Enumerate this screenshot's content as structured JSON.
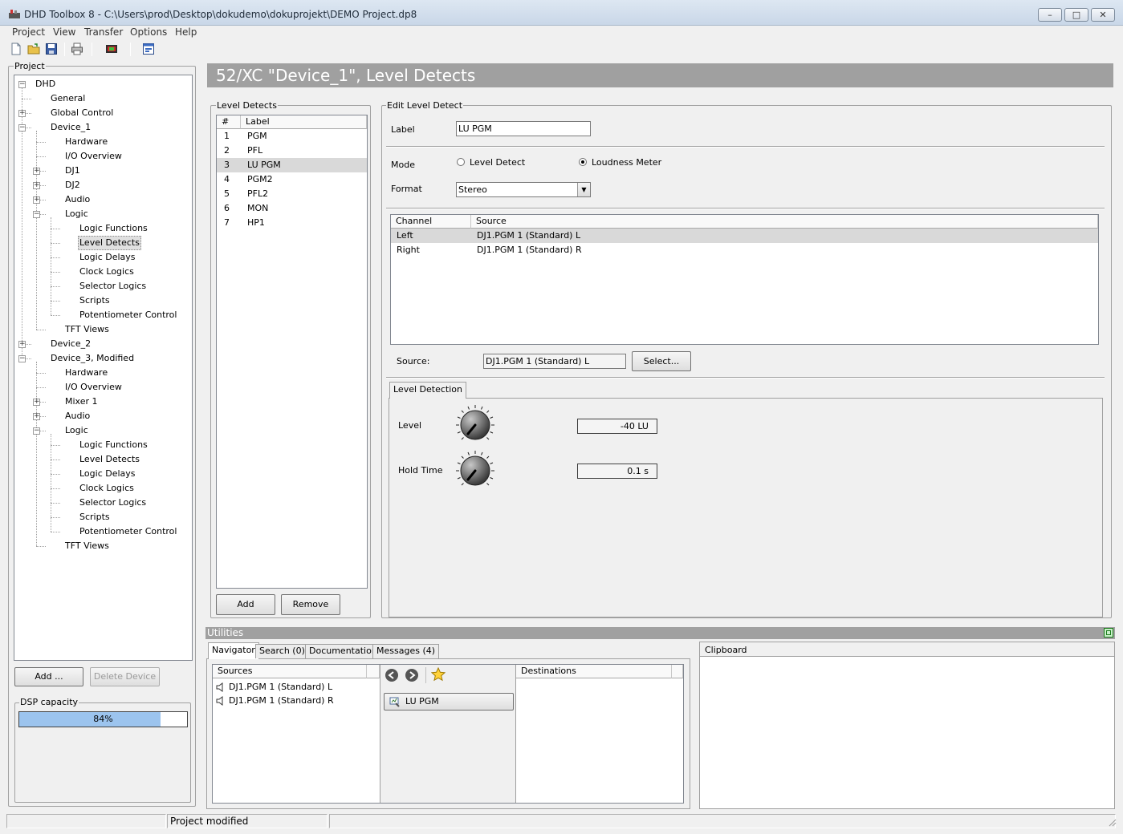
{
  "window": {
    "title": "DHD Toolbox 8 - C:\\Users\\prod\\Desktop\\dokudemo\\dokuprojekt\\DEMO Project.dp8",
    "minimize": "–",
    "maximize": "□",
    "close": "✕"
  },
  "menu": {
    "items": [
      "Project",
      "View",
      "Transfer",
      "Options",
      "Help"
    ]
  },
  "toolbar": {
    "icons": [
      "new-file-icon",
      "open-folder-icon",
      "save-icon",
      "print-icon",
      "device-icon",
      "view-icon"
    ]
  },
  "project": {
    "title": "Project",
    "tree": [
      {
        "label": "DHD",
        "exp": "-"
      },
      {
        "label": "General"
      },
      {
        "label": "Global Control",
        "exp": "+"
      },
      {
        "label": "Device_1",
        "exp": "-"
      },
      {
        "label": "Hardware"
      },
      {
        "label": "I/O Overview"
      },
      {
        "label": "DJ1",
        "exp": "+"
      },
      {
        "label": "DJ2",
        "exp": "+"
      },
      {
        "label": "Audio",
        "exp": "+"
      },
      {
        "label": "Logic",
        "exp": "-"
      },
      {
        "label": "Logic Functions"
      },
      {
        "label": "Level Detects",
        "selected": true
      },
      {
        "label": "Logic Delays"
      },
      {
        "label": "Clock Logics"
      },
      {
        "label": "Selector Logics"
      },
      {
        "label": "Scripts"
      },
      {
        "label": "Potentiometer Control"
      },
      {
        "label": "TFT Views"
      },
      {
        "label": "Device_2",
        "exp": "+"
      },
      {
        "label": "Device_3, Modified",
        "exp": "-"
      },
      {
        "label": "Hardware"
      },
      {
        "label": "I/O Overview"
      },
      {
        "label": "Mixer 1",
        "exp": "+"
      },
      {
        "label": "Audio",
        "exp": "+"
      },
      {
        "label": "Logic",
        "exp": "-"
      },
      {
        "label": "Logic Functions"
      },
      {
        "label": "Level Detects"
      },
      {
        "label": "Logic Delays"
      },
      {
        "label": "Clock Logics"
      },
      {
        "label": "Selector Logics"
      },
      {
        "label": "Scripts"
      },
      {
        "label": "Potentiometer Control"
      },
      {
        "label": "TFT Views"
      }
    ],
    "add_button": "Add ...",
    "delete_button": "Delete Device",
    "dsp_title": "DSP capacity",
    "dsp_value": "84%",
    "dsp_fraction": 0.84
  },
  "main": {
    "header": "52/XC \"Device_1\", Level Detects",
    "list": {
      "title": "Level Detects",
      "columns": [
        "#",
        "Label"
      ],
      "rows": [
        {
          "num": "1",
          "label": "PGM"
        },
        {
          "num": "2",
          "label": "PFL"
        },
        {
          "num": "3",
          "label": "LU PGM",
          "selected": true
        },
        {
          "num": "4",
          "label": "PGM2"
        },
        {
          "num": "5",
          "label": "PFL2"
        },
        {
          "num": "6",
          "label": "MON"
        },
        {
          "num": "7",
          "label": "HP1"
        }
      ],
      "add_button": "Add",
      "remove_button": "Remove"
    },
    "edit": {
      "title": "Edit Level Detect",
      "label_caption": "Label",
      "label_value": "LU PGM",
      "mode_caption": "Mode",
      "mode_option1": "Level Detect",
      "mode_option2": "Loudness Meter",
      "format_caption": "Format",
      "format_value": "Stereo",
      "channel_columns": [
        "Channel",
        "Source"
      ],
      "channels": [
        {
          "channel": "Left",
          "source": "DJ1.PGM 1 (Standard) L"
        },
        {
          "channel": "Right",
          "source": "DJ1.PGM 1 (Standard) R"
        }
      ],
      "source_caption": "Source:",
      "source_value": "DJ1.PGM 1 (Standard) L",
      "select_button": "Select...",
      "tab_label": "Level Detection",
      "level_caption": "Level",
      "level_value": "-40 LU",
      "hold_caption": "Hold Time",
      "hold_value": "0.1 s"
    }
  },
  "utilities": {
    "title": "Utilities",
    "tabs": [
      "Navigator",
      "Search (0)",
      "Documentation",
      "Messages (4)"
    ],
    "sources_header": "Sources",
    "sources": [
      "DJ1.PGM 1 (Standard) L",
      "DJ1.PGM 1 (Standard) R"
    ],
    "current_item": "LU PGM",
    "destinations_header": "Destinations",
    "clipboard_title": "Clipboard"
  },
  "status": {
    "text": "Project modified"
  }
}
